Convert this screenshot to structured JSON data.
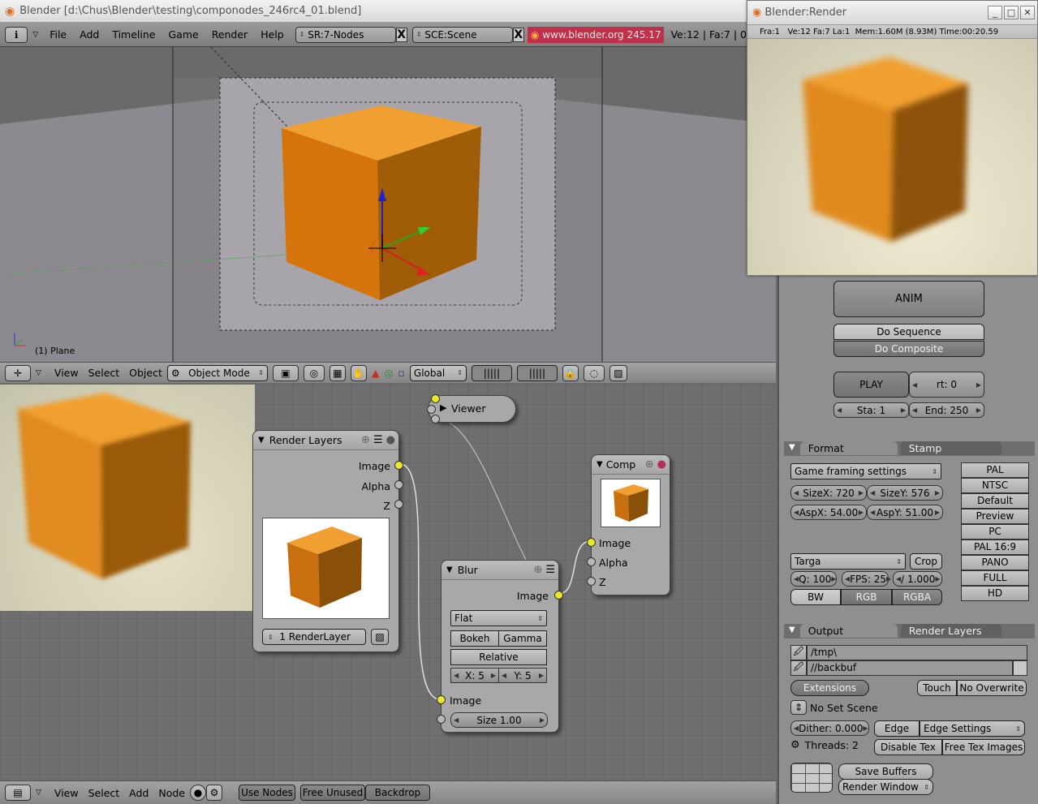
{
  "main_window": {
    "title": "Blender [d:\\Chus\\Blender\\testing\\componodes_246rc4_01.blend]"
  },
  "menubar": {
    "items": [
      "File",
      "Add",
      "Timeline",
      "Game",
      "Render",
      "Help"
    ],
    "screen_field": "SR:7-Nodes",
    "scene_field": "SCE:Scene",
    "x_label": "X",
    "site_label": "www.blender.org 245.17",
    "stats": "Ve:12 | Fa:7 | 0"
  },
  "viewport3d": {
    "object_label": "(1) Plane",
    "header": {
      "menus": [
        "View",
        "Select",
        "Object"
      ],
      "mode": "Object Mode",
      "orientation": "Global"
    }
  },
  "render_window": {
    "title": "Blender:Render",
    "info": "Fra:1   Ve:12 Fa:7 La:1  Mem:1.60M (8.93M) Time:00:20.59"
  },
  "node_editor": {
    "nodes": {
      "viewer": {
        "title": "Viewer"
      },
      "render_layers": {
        "title": "Render Layers",
        "outputs": [
          "Image",
          "Alpha",
          "Z"
        ],
        "layer": "1 RenderLayer"
      },
      "blur": {
        "title": "Blur",
        "output": "Image",
        "filter": "Flat",
        "bokeh": "Bokeh",
        "gamma": "Gamma",
        "relative": "Relative",
        "x": "X: 5",
        "y": "Y: 5",
        "input": "Image",
        "size": "Size 1.00"
      },
      "composite": {
        "title": "Comp",
        "inputs": [
          "Image",
          "Alpha",
          "Z"
        ]
      }
    },
    "header": {
      "menus": [
        "View",
        "Select",
        "Add",
        "Node"
      ],
      "use_nodes": "Use Nodes",
      "free_unused": "Free Unused",
      "backdrop": "Backdrop"
    }
  },
  "render_panel": {
    "anim": "ANIM",
    "do_sequence": "Do Sequence",
    "do_composite": "Do Composite",
    "play": "PLAY",
    "rt": "rt: 0",
    "sta": "Sta: 1",
    "end": "End: 250",
    "format_tabs": [
      "Format",
      "Stamp"
    ],
    "game_framing": "Game framing settings",
    "size_x": "SizeX: 720",
    "size_y": "SizeY: 576",
    "asp_x": "AspX: 54.00",
    "asp_y": "AspY: 51.00",
    "presets": [
      "PAL",
      "NTSC",
      "Default",
      "Preview",
      "PC",
      "PAL 16:9",
      "PANO",
      "FULL",
      "HD"
    ],
    "file_format": "Targa",
    "crop": "Crop",
    "quality": "Q: 100",
    "fps": "FPS: 25",
    "fps_base": "/ 1.000",
    "color_modes": [
      "BW",
      "RGB",
      "RGBA"
    ],
    "output_tabs": [
      "Output",
      "Render Layers"
    ],
    "paths": [
      "/tmp\\",
      "//backbuf"
    ],
    "extensions": "Extensions",
    "touch": "Touch",
    "no_overwrite": "No Overwrite",
    "no_set_scene": "No Set Scene",
    "dither": "Dither: 0.000",
    "edge": "Edge",
    "edge_settings": "Edge Settings",
    "threads": "Threads: 2",
    "disable_tex": "Disable Tex",
    "free_tex_images": "Free Tex Images",
    "save_buffers": "Save Buffers",
    "render_window": "Render Window"
  },
  "colors": {
    "cube_top": "#f0a030",
    "cube_front": "#c86a08",
    "cube_side": "#9a5a08",
    "socket_yellow": "#e8e82a",
    "site_red": "#c0304a"
  }
}
